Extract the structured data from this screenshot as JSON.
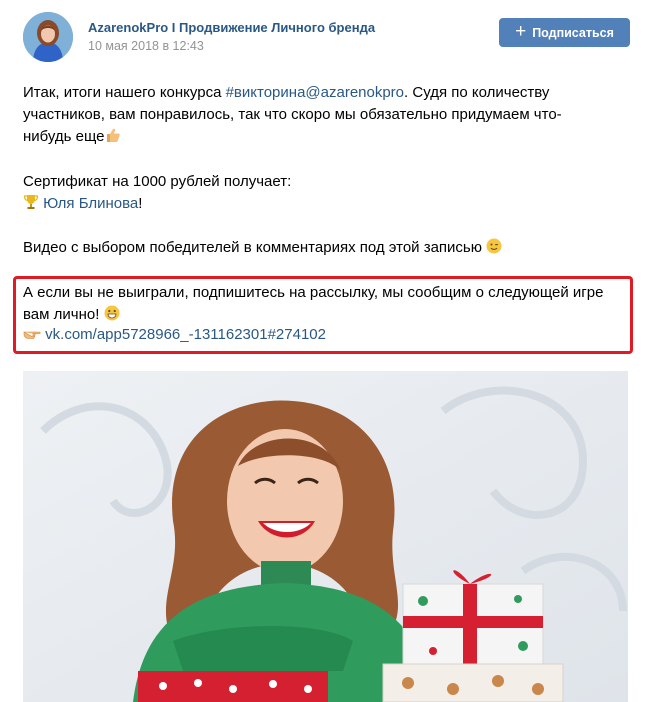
{
  "post": {
    "author": "AzarenokPro I Продвижение Личного бренда",
    "date": "10 мая 2018 в 12:43",
    "subscribe_label": "Подписаться",
    "subscribe_icon": "plus-icon",
    "body": {
      "line1_prefix": "Итак, итоги нашего конкурса ",
      "hashtag": "#викторина@azarenokpro",
      "line1_suffix": ". Судя по количеству",
      "line2": "участников, вам понравилось, так что скоро мы обязательно придумаем что-",
      "line3": "нибудь еще",
      "line3_emoji": "thumbs-up-icon",
      "certificate": "Сертификат на 1000 рублей получает:",
      "winner_emoji": "trophy-icon",
      "winner_name": "Юля Блинова",
      "winner_suffix": "!",
      "video": "Видео с выбором победителей в комментариях под этой записью",
      "video_emoji": "winking-face-icon",
      "highlight_line1": "А если вы не выиграли, подпишитесь на рассылку, мы сообщим о следующей игре",
      "highlight_line2": "вам лично!",
      "highlight_emoji": "grinning-face-icon",
      "link_emoji": "pointing-hand-icon",
      "link": "vk.com/app5728966_-131162301#274102"
    }
  },
  "colors": {
    "link": "#2a5885",
    "button": "#5181b8",
    "highlight_border": "#e01b24",
    "date": "#939393"
  }
}
